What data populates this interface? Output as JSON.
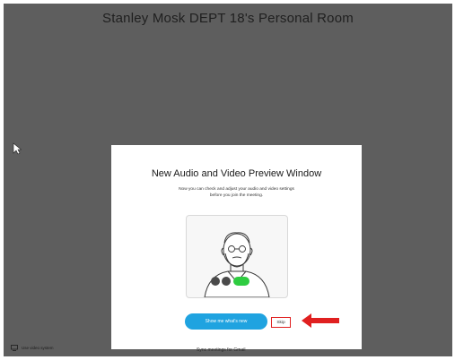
{
  "room": {
    "title": "Stanley Mosk DEPT 18's Personal Room"
  },
  "dialog": {
    "title": "New Audio and Video Preview Window",
    "description_line1": "Now you can check and adjust your audio and video settings",
    "description_line2": "before you join the meeting.",
    "show_button_label": "Show me what's new",
    "skip_button_label": "Skip"
  },
  "bottom_bar": {
    "video_system_label": "Use video system",
    "center_label": "Sync meetings for Gmail"
  },
  "colors": {
    "background": "#5e5e5e",
    "accent_blue": "#1fa3e0",
    "toggle_green": "#2ecc40",
    "annotation_red": "#e02020"
  }
}
